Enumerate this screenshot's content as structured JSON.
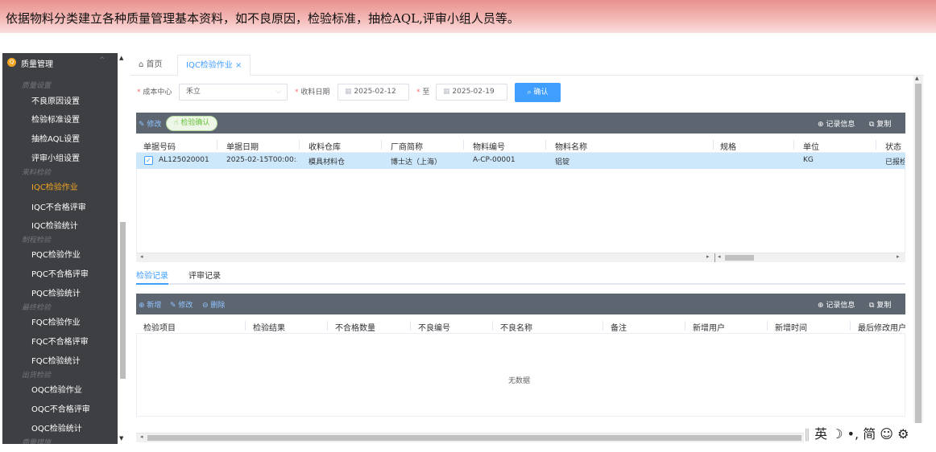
{
  "banner": {
    "text": "依据物料分类建立各种质量管理基本资料，如不良原因，检验标准，抽检AQL,评审小组人员等。"
  },
  "sidebar": {
    "header": {
      "icon": "quality-management-icon",
      "title": "质量管理",
      "chevron": "^"
    },
    "groups": [
      {
        "title": "质量设置",
        "items": [
          "不良原因设置",
          "检验标准设置",
          "抽检AQL设置",
          "评审小组设置"
        ]
      },
      {
        "title": "来料检验",
        "items": [
          "IQC检验作业",
          "IQC不合格评审",
          "IQC检验统计"
        ]
      },
      {
        "title": "制程检验",
        "items": [
          "PQC检验作业",
          "PQC不合格评审",
          "PQC检验统计"
        ]
      },
      {
        "title": "最终检验",
        "items": [
          "FQC检验作业",
          "FQC不合格评审",
          "FQC检验统计"
        ]
      },
      {
        "title": "出货检验",
        "items": [
          "OQC检验作业",
          "OQC不合格评审",
          "OQC检验统计"
        ]
      },
      {
        "title": "质量措施",
        "items": []
      }
    ],
    "active_item": "IQC检验作业"
  },
  "tabs": [
    {
      "label": "首页",
      "icon": "home-icon"
    },
    {
      "label": "IQC检验作业",
      "close": "×"
    }
  ],
  "filters": {
    "cost_center_label": "成本中心",
    "cost_center_value": "禾立",
    "receive_date_label": "收料日期",
    "date_from": "2025-02-12",
    "to_label": "至",
    "date_to": "2025-02-19",
    "confirm_label": "确认"
  },
  "master_toolbar": {
    "edit_label": "修改",
    "inspect_confirm_label": "检验确认",
    "record_info_label": "记录信息",
    "copy_label": "复制"
  },
  "master_table": {
    "columns": [
      "单据号码",
      "单据日期",
      "收料仓库",
      "厂商简称",
      "物料编号",
      "物料名称",
      "规格",
      "单位",
      "状态"
    ],
    "rows": [
      {
        "checked": true,
        "doc_no": "AL125020001",
        "doc_date": "2025-02-15T00:00:...",
        "warehouse": "模具材料仓",
        "vendor": "博士达（上海）",
        "item_no": "A-CP-00001",
        "item_name": "铝锭",
        "spec": "",
        "unit": "KG",
        "status": "已报检"
      }
    ]
  },
  "sub_tabs": [
    "检验记录",
    "评审记录"
  ],
  "detail_toolbar": {
    "add_label": "新增",
    "edit_label": "修改",
    "delete_label": "删除",
    "record_info_label": "记录信息",
    "copy_label": "复制"
  },
  "detail_table": {
    "columns": [
      "检验项目",
      "检验结果",
      "不合格数量",
      "不良编号",
      "不良名称",
      "备注",
      "新增用户",
      "新增时间",
      "最后修改用户"
    ],
    "rows": [],
    "empty_text": "无数据"
  },
  "ime_bar": {
    "text": "英 ☽ •, 简 ☺ ⚙"
  },
  "colors": {
    "accent": "#409eff",
    "sidebar_bg": "#3e3f42",
    "active_menu": "#f2a624",
    "toolbar_bg": "#5d6670",
    "selected_row": "#cde8fb"
  }
}
